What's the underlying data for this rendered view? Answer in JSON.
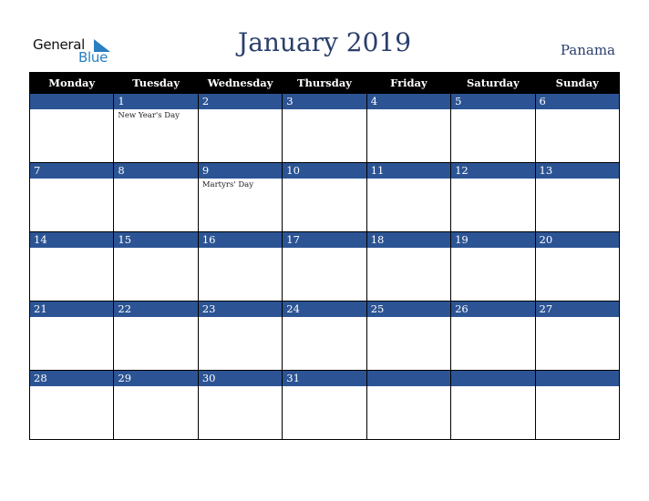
{
  "logo": {
    "text_general": "General",
    "text_blue": "Blue",
    "icon": "triangle-flag-icon"
  },
  "title": "January 2019",
  "country": "Panama",
  "weekdays": [
    "Monday",
    "Tuesday",
    "Wednesday",
    "Thursday",
    "Friday",
    "Saturday",
    "Sunday"
  ],
  "weeks": [
    [
      {
        "day": ""
      },
      {
        "day": "1",
        "holiday": "New Year's Day"
      },
      {
        "day": "2"
      },
      {
        "day": "3"
      },
      {
        "day": "4"
      },
      {
        "day": "5"
      },
      {
        "day": "6"
      }
    ],
    [
      {
        "day": "7"
      },
      {
        "day": "8"
      },
      {
        "day": "9",
        "holiday": "Martyrs' Day"
      },
      {
        "day": "10"
      },
      {
        "day": "11"
      },
      {
        "day": "12"
      },
      {
        "day": "13"
      }
    ],
    [
      {
        "day": "14"
      },
      {
        "day": "15"
      },
      {
        "day": "16"
      },
      {
        "day": "17"
      },
      {
        "day": "18"
      },
      {
        "day": "19"
      },
      {
        "day": "20"
      }
    ],
    [
      {
        "day": "21"
      },
      {
        "day": "22"
      },
      {
        "day": "23"
      },
      {
        "day": "24"
      },
      {
        "day": "25"
      },
      {
        "day": "26"
      },
      {
        "day": "27"
      }
    ],
    [
      {
        "day": "28"
      },
      {
        "day": "29"
      },
      {
        "day": "30"
      },
      {
        "day": "31"
      },
      {
        "day": ""
      },
      {
        "day": ""
      },
      {
        "day": ""
      }
    ]
  ],
  "colors": {
    "header_bg": "#000000",
    "day_band": "#2c5494",
    "title": "#2a3f6b",
    "logo_blue": "#2a7fc0"
  }
}
